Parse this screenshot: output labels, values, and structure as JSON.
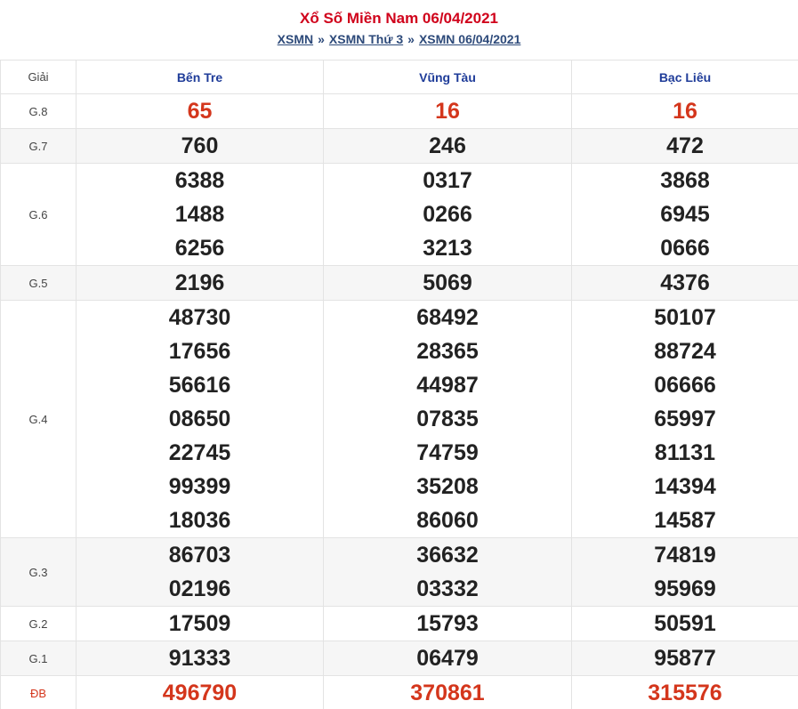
{
  "header": {
    "title": "Xổ Số Miền Nam 06/04/2021",
    "breadcrumb": [
      "XSMN",
      "XSMN Thứ 3",
      "XSMN 06/04/2021"
    ],
    "separator": "»"
  },
  "table": {
    "prize_header": "Giải",
    "provinces": [
      "Bến Tre",
      "Vũng Tàu",
      "Bạc Liêu"
    ],
    "rows": [
      {
        "prize": "G.8",
        "highlight": true,
        "values": [
          [
            "65"
          ],
          [
            "16"
          ],
          [
            "16"
          ]
        ]
      },
      {
        "prize": "G.7",
        "values": [
          [
            "760"
          ],
          [
            "246"
          ],
          [
            "472"
          ]
        ]
      },
      {
        "prize": "G.6",
        "values": [
          [
            "6388",
            "1488",
            "6256"
          ],
          [
            "0317",
            "0266",
            "3213"
          ],
          [
            "3868",
            "6945",
            "0666"
          ]
        ]
      },
      {
        "prize": "G.5",
        "values": [
          [
            "2196"
          ],
          [
            "5069"
          ],
          [
            "4376"
          ]
        ]
      },
      {
        "prize": "G.4",
        "values": [
          [
            "48730",
            "17656",
            "56616",
            "08650",
            "22745",
            "99399",
            "18036"
          ],
          [
            "68492",
            "28365",
            "44987",
            "07835",
            "74759",
            "35208",
            "86060"
          ],
          [
            "50107",
            "88724",
            "06666",
            "65997",
            "81131",
            "14394",
            "14587"
          ]
        ]
      },
      {
        "prize": "G.3",
        "values": [
          [
            "86703",
            "02196"
          ],
          [
            "36632",
            "03332"
          ],
          [
            "74819",
            "95969"
          ]
        ]
      },
      {
        "prize": "G.2",
        "values": [
          [
            "17509"
          ],
          [
            "15793"
          ],
          [
            "50591"
          ]
        ]
      },
      {
        "prize": "G.1",
        "values": [
          [
            "91333"
          ],
          [
            "06479"
          ],
          [
            "95877"
          ]
        ]
      },
      {
        "prize": "ĐB",
        "highlight": true,
        "values": [
          [
            "496790"
          ],
          [
            "370861"
          ],
          [
            "315576"
          ]
        ]
      }
    ]
  },
  "colors": {
    "title": "#d0021b",
    "highlight": "#d4361c",
    "province": "#1f3c99",
    "link": "#2d4a7a"
  }
}
